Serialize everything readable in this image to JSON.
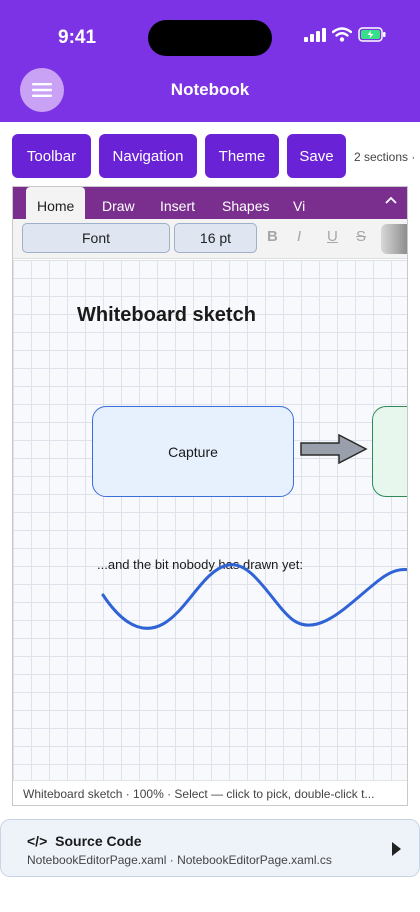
{
  "status": {
    "time": "9:41"
  },
  "header": {
    "title": "Notebook",
    "menu_icon": "hamburger-icon"
  },
  "toolbar": {
    "buttons": [
      "Toolbar",
      "Navigation",
      "Theme",
      "Save"
    ],
    "sections_text": "2 sections ·"
  },
  "ribbon": {
    "tabs": [
      "Home",
      "Draw",
      "Insert",
      "Shapes",
      "Vi"
    ],
    "active_tab": "Home",
    "font_label": "Font",
    "size_label": "16 pt",
    "format_buttons": [
      "B",
      "I",
      "U",
      "S"
    ]
  },
  "canvas": {
    "title": "Whiteboard sketch",
    "capture_label": "Capture",
    "note": "...and the bit nobody has drawn yet:"
  },
  "status_bar": {
    "text": "Whiteboard sketch · 100% · Select — click to pick, double-click t..."
  },
  "source": {
    "icon": "</>",
    "title": "Source Code",
    "files": "NotebookEditorPage.xaml · NotebookEditorPage.xaml.cs"
  },
  "colors": {
    "accent": "#7c33e6",
    "button": "#6a22d6",
    "ribbon": "#7a2f8e",
    "capture_border": "#3a6fd8",
    "wave": "#2f63d6"
  }
}
